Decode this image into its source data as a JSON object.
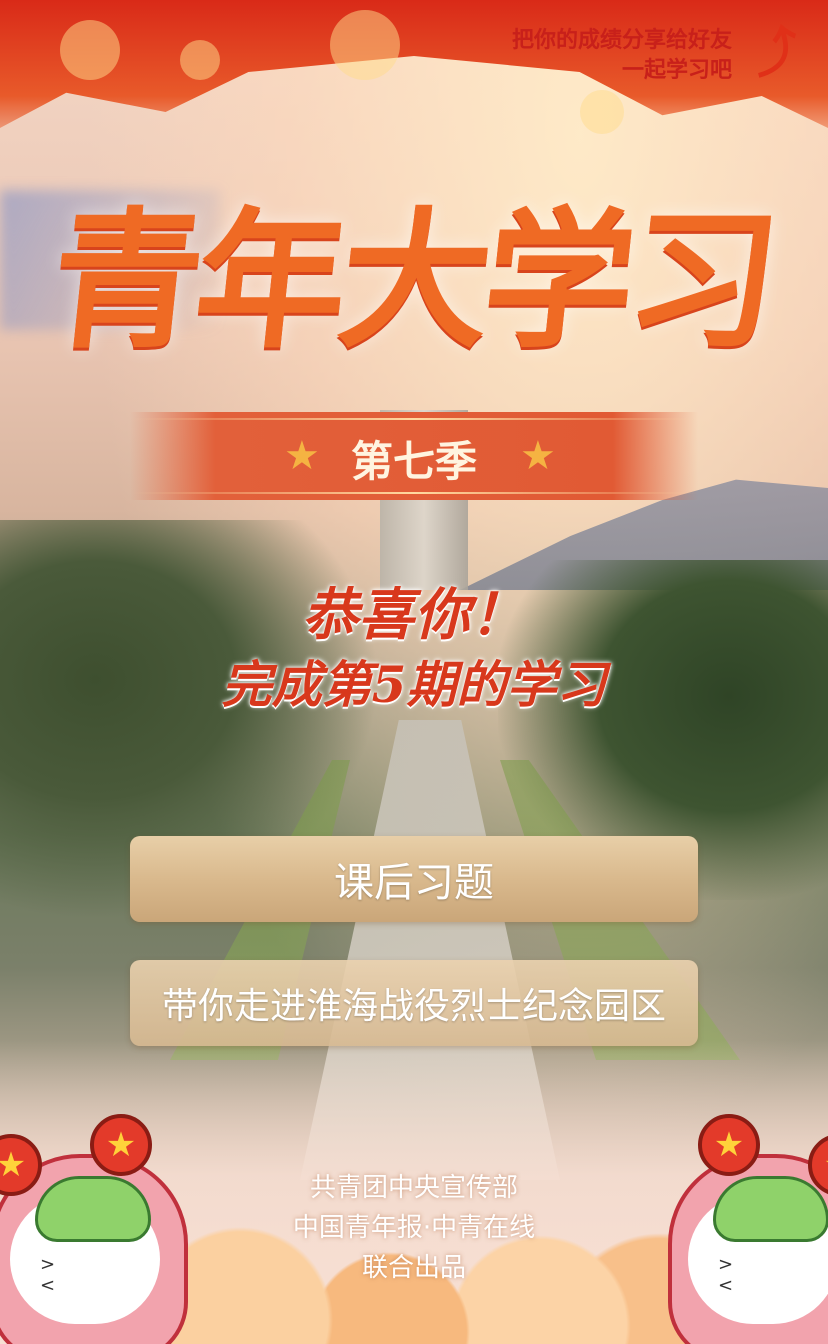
{
  "share": {
    "line1": "把你的成绩分享给好友",
    "line2": "一起学习吧"
  },
  "title": "青年大学习",
  "season": "第七季",
  "congrats": {
    "line1": "恭喜你！",
    "line2": "完成第5期的学习"
  },
  "buttons": {
    "exercises": "课后习题",
    "tour": "带你走进淮海战役烈士纪念园区"
  },
  "footer": {
    "line1": "共青团中央宣传部",
    "line2": "中国青年报·中青在线",
    "line3": "联合出品"
  },
  "icons": {
    "share": "share-arrow-icon",
    "star": "star-icon"
  },
  "colors": {
    "accent_red": "#d8381c",
    "title_orange": "#ef6a24",
    "button_gold": "#d9b98d"
  }
}
